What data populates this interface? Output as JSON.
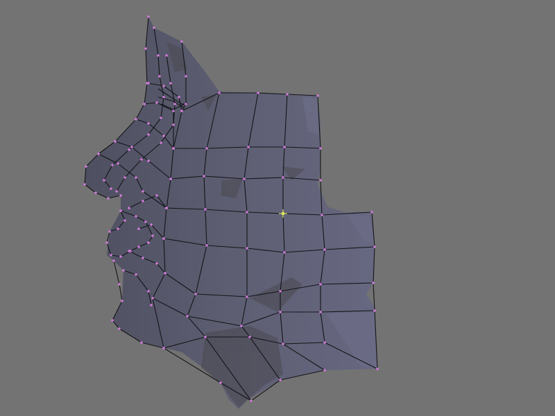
{
  "viewport": {
    "background": "#737373"
  },
  "mesh": {
    "object": "face-mesh",
    "mode": "edit",
    "colors": {
      "face_fill": "#5a5b6e",
      "face_fill_light": "#6a6b80",
      "face_shadow": "#4a4850",
      "edge": "#141418",
      "vertex": "#d07ad8",
      "selected_vertex": "#e6f05a"
    }
  }
}
